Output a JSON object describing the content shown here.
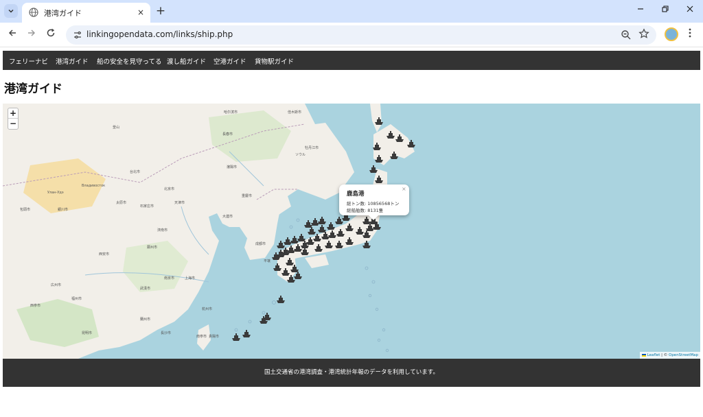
{
  "browser": {
    "tab_title": "港湾ガイド",
    "tab_close_glyph": "×",
    "new_tab_glyph": "+",
    "url": "linkingopendata.com/links/ship.php",
    "icons": [
      "tab-search-icon",
      "globe-icon",
      "close-icon",
      "plus-icon",
      "minimize-icon",
      "restore-icon",
      "window-close-icon",
      "back-arrow-icon",
      "forward-arrow-icon",
      "reload-icon",
      "site-info-icon",
      "zoom-icon",
      "star-icon",
      "profile-avatar",
      "more-menu-icon"
    ]
  },
  "site_nav": {
    "items": [
      "フェリーナビ",
      "港湾ガイド",
      "船の安全を見守ってる",
      "渡し船ガイド",
      "空港ガイド",
      "貨物駅ガイド"
    ]
  },
  "page": {
    "title": "港湾ガイド"
  },
  "map": {
    "zoom_in": "+",
    "zoom_out": "−",
    "popup": {
      "title": "鹿島港",
      "line1": "総トン数: 10856568トン",
      "line2": "総船舶数: 8131隻",
      "close": "×"
    },
    "attribution": {
      "leaflet": "Leaflet",
      "separator": " | © ",
      "osm": "OpenStreetMap"
    },
    "labels": [
      "哈尔滨市",
      "佳木斯市",
      "牡丹江市",
      "長春市",
      "瀋陽市",
      "大連市",
      "北京市",
      "天津市",
      "石家庄市",
      "太原市",
      "済南市",
      "鄭州市",
      "西安市",
      "武漢市",
      "南京市",
      "上海市",
      "杭州市",
      "長沙市",
      "福州市",
      "広州市",
      "重慶市",
      "成都市",
      "平壌",
      "ソウル",
      "釜山",
      "Владивосток",
      "Улан-Удэ",
      "包頭市",
      "銀川市",
      "西寧市",
      "蘭州市",
      "昆明市",
      "貴陽市",
      "南寧市",
      "台北市"
    ],
    "colors": {
      "sea": "#aad3df",
      "land": "#f2efe9",
      "marker": "#3a3a3a"
    }
  },
  "footer": {
    "text": "国土交通省の港湾調査・港湾統計年報のデータを利用しています。"
  }
}
